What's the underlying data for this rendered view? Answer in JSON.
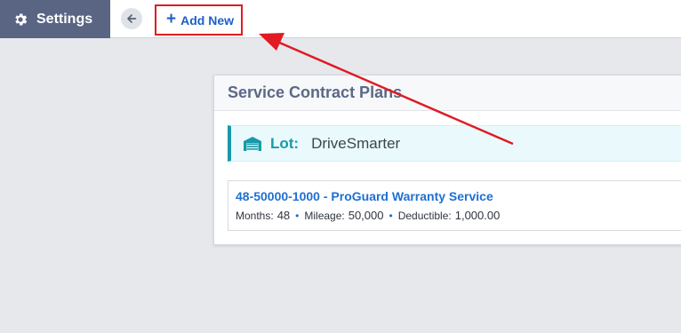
{
  "header": {
    "settings_label": "Settings",
    "add_new_label": "Add New"
  },
  "panel": {
    "title": "Service Contract Plans",
    "lot_label": "Lot:",
    "lot_value": "DriveSmarter"
  },
  "plan": {
    "title": "48-50000-1000 - ProGuard Warranty Service",
    "months_label": "Months:",
    "months_value": "48",
    "mileage_label": "Mileage:",
    "mileage_value": "50,000",
    "deductible_label": "Deductible:",
    "deductible_value": "1,000.00"
  },
  "colors": {
    "settings_bg": "#5a6584",
    "accent_blue": "#1f6fd1",
    "teal": "#1899a8",
    "annotation_red": "#e01b24"
  },
  "icons": [
    "gear-icon",
    "back-arrow-icon",
    "plus-icon",
    "garage-icon",
    "annotation-arrow"
  ]
}
